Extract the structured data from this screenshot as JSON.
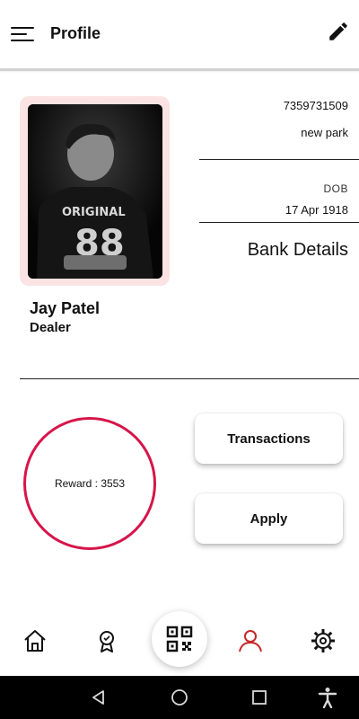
{
  "header": {
    "title": "Profile",
    "menu_icon": "menu-icon",
    "edit_icon": "pencil-icon"
  },
  "profile": {
    "phone": "7359731509",
    "address": "new park",
    "dob_label": "DOB",
    "dob_value": "17 Apr 1918",
    "bank_details": "Bank Details",
    "name": "Jay Patel",
    "role": "Dealer",
    "photo_shirt_text": "ORIGINAL"
  },
  "reward": {
    "text": "Reward : 3553",
    "ring_color": "#d6154a"
  },
  "actions": {
    "transactions": "Transactions",
    "apply": "Apply"
  },
  "bottom_nav": {
    "items": [
      "home-icon",
      "badge-icon",
      "qr-code-icon",
      "profile-icon",
      "settings-icon"
    ],
    "active": "profile-icon",
    "active_color": "#c62828"
  },
  "system_nav": [
    "back-icon",
    "home-circle-icon",
    "recents-icon",
    "accessibility-icon"
  ]
}
